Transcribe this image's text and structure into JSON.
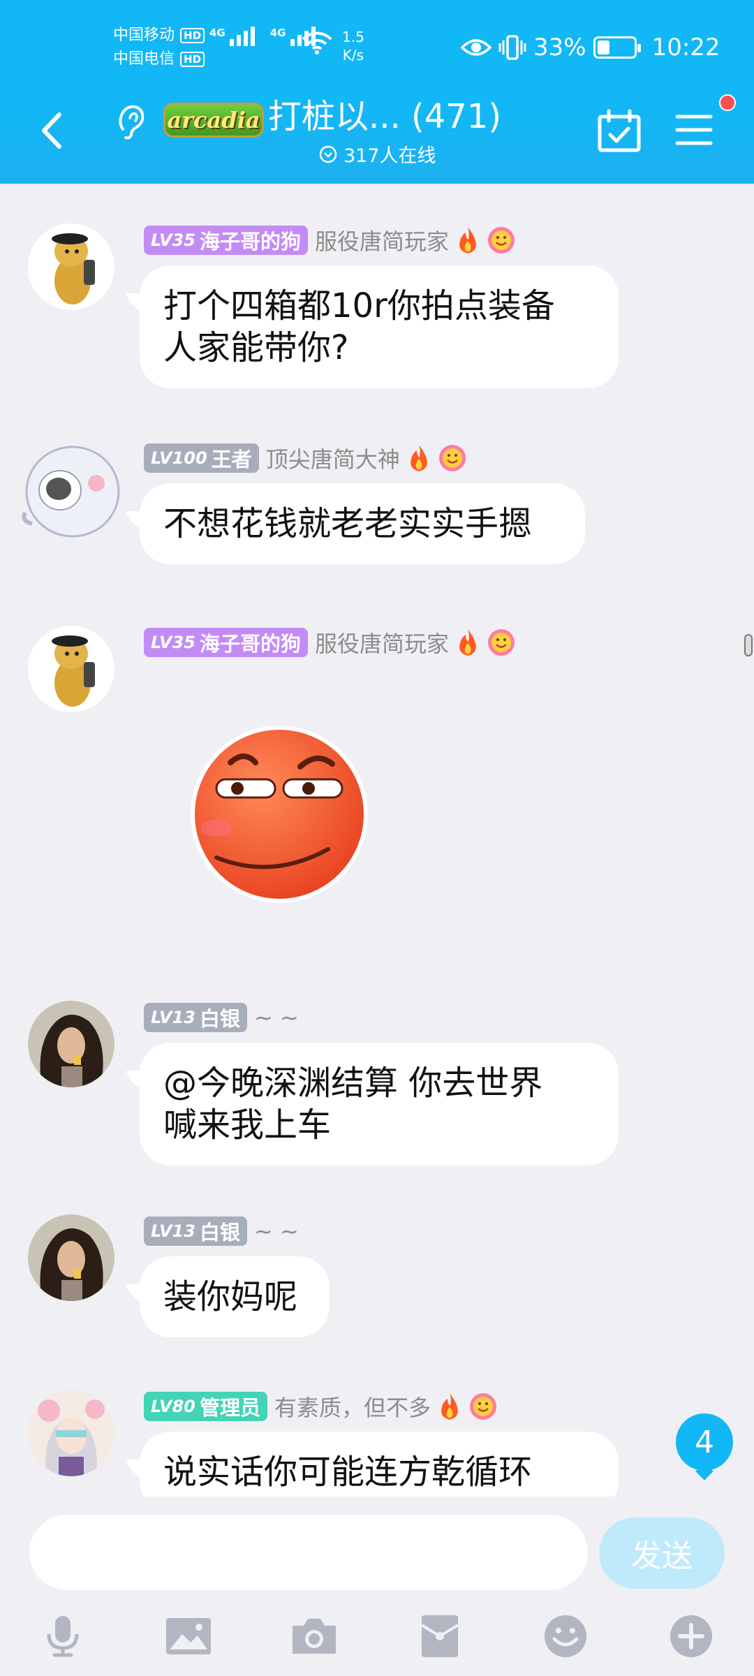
{
  "status_bar": {
    "carrier1": "中国移动",
    "carrier2": "中国电信",
    "hd": "HD",
    "network1": "4G",
    "network2": "4G",
    "speed_value": "1.5",
    "speed_unit": "K/s",
    "battery_percent": "33%",
    "battery_level": 0.33,
    "time": "10:22"
  },
  "header": {
    "group_logo_text": "arcadia",
    "group_title": "打桩以... (471)",
    "online": "317人在线"
  },
  "messages": [
    {
      "level": "LV35",
      "badge": "海子哥的狗",
      "badge_color": "#c38cf5",
      "title": "服役唐简玩家",
      "text_line1": "打个四箱都10r你拍点装备",
      "text_line2": "人家能带你?"
    },
    {
      "level": "LV100",
      "badge": "王者",
      "badge_color": "#a8adbb",
      "title": "顶尖唐简大神",
      "text_line1": "不想花钱就老老实实手摁"
    },
    {
      "level": "LV35",
      "badge": "海子哥的狗",
      "badge_color": "#c38cf5",
      "title": "服役唐简玩家",
      "sticker": "smirk-face-sticker"
    },
    {
      "level": "LV13",
      "badge": "白银",
      "badge_color": "#a8adbb",
      "title": "~ ~",
      "text_line1": "@今晚深渊结算 你去世界",
      "text_line2": "喊来我上车"
    },
    {
      "level": "LV13",
      "badge": "白银",
      "badge_color": "#a8adbb",
      "title": "~ ~",
      "text_line1": "装你妈呢"
    },
    {
      "level": "LV80",
      "badge": "管理员",
      "badge_color": "#43d3b5",
      "title": "有素质，但不多",
      "text_line1": "说实话你可能连方乾循环"
    }
  ],
  "unread_count": "4",
  "input": {
    "value": "",
    "send_label": "发送"
  },
  "toolbar": [
    "mic-icon",
    "image-icon",
    "camera-icon",
    "red-packet-icon",
    "emoji-icon",
    "plus-icon"
  ],
  "colors": {
    "accent": "#12b7f5",
    "background": "#efeff4",
    "send_disabled": "#bfeafb"
  }
}
